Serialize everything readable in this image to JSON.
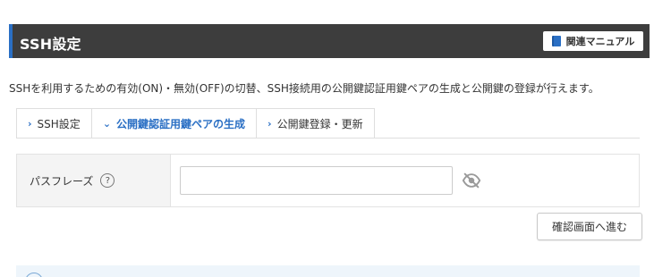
{
  "header": {
    "title": "SSH設定",
    "manual_label": "関連マニュアル",
    "manual_icon": "book-icon",
    "accent_color": "#2a6fc4",
    "bar_color": "#3d3d3d"
  },
  "description": "SSHを利用するための有効(ON)・無効(OFF)の切替、SSH接続用の公開鍵認証用鍵ペアの生成と公開鍵の登録が行えます。",
  "tabs": [
    {
      "label": "SSH設定",
      "icon": "chevron-right-icon",
      "chevron": "›",
      "active": false
    },
    {
      "label": "公開鍵認証用鍵ペアの生成",
      "icon": "chevron-down-icon",
      "chevron": "⌄",
      "active": true
    },
    {
      "label": "公開鍵登録・更新",
      "icon": "chevron-right-icon",
      "chevron": "›",
      "active": false
    }
  ],
  "form": {
    "passphrase_label": "パスフレーズ",
    "help_symbol": "?",
    "passphrase_value": "",
    "passphrase_placeholder": "",
    "visibility_icon": "eye-slash-icon"
  },
  "actions": {
    "confirm_label": "確認画面へ進む"
  }
}
